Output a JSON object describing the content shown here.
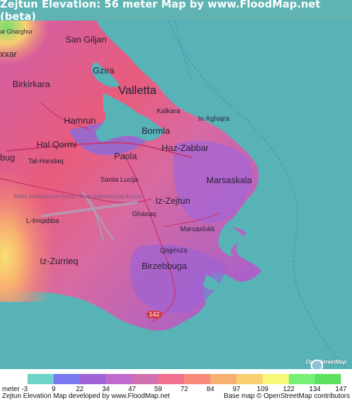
{
  "title": "Zejtun Elevation: 56 meter Map by www.FloodMap.net (beta)",
  "map": {
    "places": {
      "san_giljan": "San Giljan",
      "gzira": "Gzira",
      "birkirkara": "Birkirkara",
      "valletta": "Valletta",
      "hamrun": "Hamrun",
      "kalkara": "Kalkara",
      "ix_xghajra": "Ix-Xghajra",
      "bormla": "Bormla",
      "hal_qormi": "Hal Qormi",
      "paola": "Paola",
      "haz_zabbar": "Haz-Zabbar",
      "tal_handaq": "Tal-Handaq",
      "santa_lucija": "Santa Lucija",
      "marsaskala": "Marsaskala",
      "iz_zejtun": "Iz-Zejtun",
      "ghaxaq": "Ghaxaq",
      "l_imqabba": "L-Imqabba",
      "marsaxlokk": "Marsaxlokk",
      "qajjenza": "Qajjenza",
      "iz_zurrieq": "Iz-Zurrieq",
      "birzebbuga": "Birzebbuga",
      "hal_gharghur": "al Gharghur",
      "ixxar": "xxar",
      "bug": "bug"
    },
    "ghost_labels": {
      "airport_1": "Malta International Airport",
      "airport_2": "Malta International Airport"
    },
    "road_shield": "142",
    "osm_logo_text": "OpenStreetMap"
  },
  "legend": {
    "unit": "meter",
    "ticks": [
      "-3",
      "9",
      "22",
      "34",
      "47",
      "59",
      "72",
      "84",
      "97",
      "109",
      "122",
      "134",
      "147"
    ],
    "colors": [
      "#6fd3c8",
      "#7878f0",
      "#a064d8",
      "#c06ad0",
      "#d070b0",
      "#f07090",
      "#f88a7a",
      "#f8b070",
      "#f8d070",
      "#f8f878",
      "#78f078",
      "#60e060"
    ],
    "credit_left": "Zejtun Elevation Map developed by www.FloodMap.net",
    "credit_right": "Base map © OpenStreetMap contributors"
  }
}
